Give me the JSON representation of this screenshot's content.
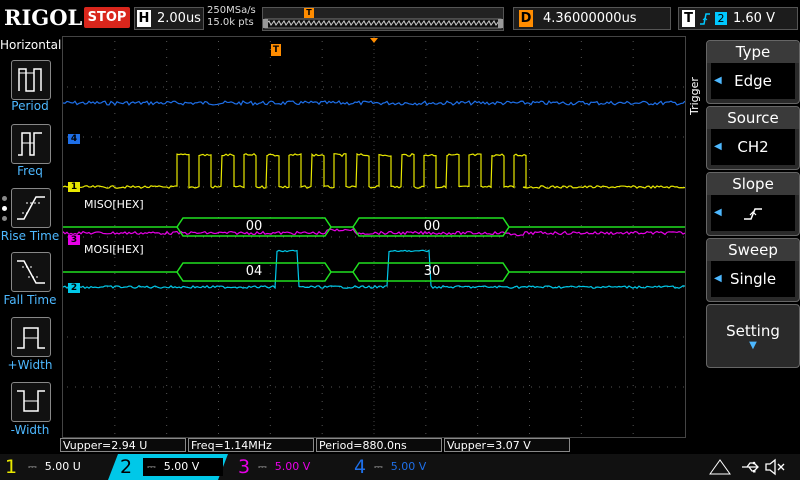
{
  "top": {
    "brand": "RIGOL",
    "run_state": "STOP",
    "horizontal": {
      "key": "H",
      "value": "2.00us"
    },
    "sample_rate": "250MSa/s",
    "points": "15.0k pts",
    "delay": {
      "key": "D",
      "value": "4.36000000us"
    },
    "trigger": {
      "key": "T",
      "channel": "2",
      "level": "1.60 V"
    },
    "trigger_marker": "T"
  },
  "left": {
    "title": "Horizontal",
    "items": [
      {
        "label": "Period",
        "icon": "period-icon"
      },
      {
        "label": "Freq",
        "icon": "freq-icon"
      },
      {
        "label": "Rise Time",
        "icon": "rise-time-icon"
      },
      {
        "label": "Fall Time",
        "icon": "fall-time-icon"
      },
      {
        "label": "+Width",
        "icon": "positive-width-icon"
      },
      {
        "label": "-Width",
        "icon": "negative-width-icon"
      }
    ]
  },
  "right": {
    "side_label": "Trigger",
    "menu": [
      {
        "title": "Type",
        "value": "Edge"
      },
      {
        "title": "Source",
        "value": "CH2"
      },
      {
        "title": "Slope",
        "value": ""
      },
      {
        "title": "Sweep",
        "value": "Single"
      }
    ],
    "setting": "Setting"
  },
  "traces": {
    "markers": [
      "4",
      "1",
      "3",
      "2"
    ],
    "level_marker": "T",
    "miso_label": "MISO[HEX]",
    "mosi_label": "MOSI[HEX]",
    "miso_bytes": [
      "00",
      "00"
    ],
    "mosi_bytes": [
      "04",
      "30"
    ],
    "colors": {
      "ch1": "#e8e800",
      "ch2": "#00c8e8",
      "ch3": "#e800e8",
      "ch4": "#1e6fe8",
      "decode": "#20e020"
    }
  },
  "measurements": [
    "Vupper=2.94 U",
    "Freq=1.14MHz",
    "Period=880.0ns",
    "Vupper=3.07 V"
  ],
  "bottom": {
    "channels": [
      {
        "num": "1",
        "value": "5.00 U",
        "color": "#e8e800"
      },
      {
        "num": "2",
        "value": "5.00 V",
        "color": "#00c8e8"
      },
      {
        "num": "3",
        "value": "5.00 V",
        "color": "#e800e8"
      },
      {
        "num": "4",
        "value": "5.00 V",
        "color": "#1e6fe8"
      }
    ]
  }
}
